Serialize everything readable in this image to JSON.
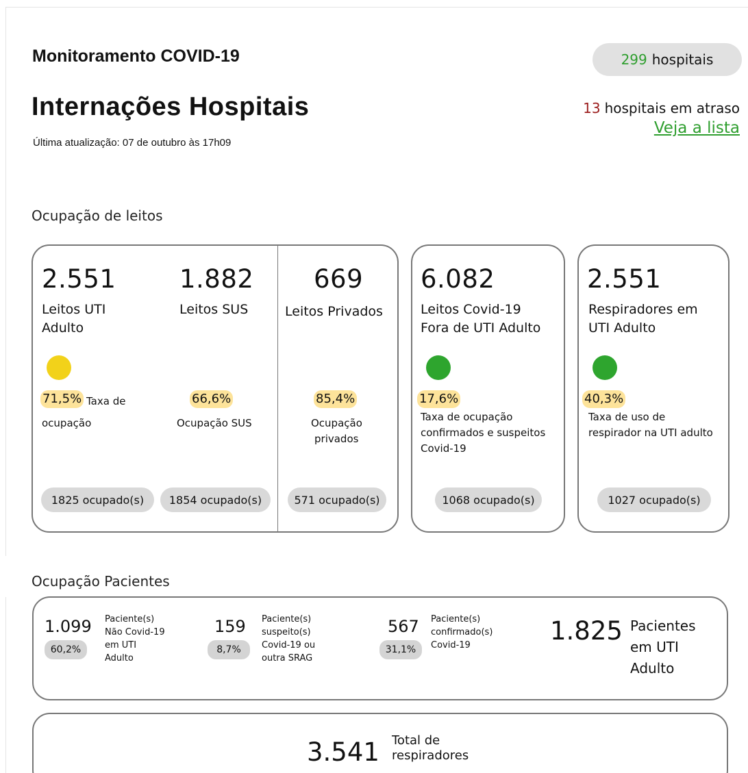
{
  "header": {
    "app_title": "Monitoramento COVID-19",
    "page_title": "Internações Hospitais",
    "last_update": "Última atualização: 07 de outubro às 17h09",
    "hospitals_count": "299",
    "hospitals_label": "hospitais",
    "late_count": "13",
    "late_label": "hospitais em atraso",
    "late_link": "Veja a lista"
  },
  "colors": {
    "yellow_status": "#f2d21a",
    "green_status": "#2ea52e",
    "highlight": "#fde39a",
    "accent_green": "#2e9e2e",
    "alert_red": "#9b1c1c"
  },
  "leitos": {
    "section_title": "Ocupação de leitos",
    "uti": {
      "value": "2.551",
      "label_line1": "Leitos UTI",
      "label_line2": "Adulto",
      "status_icon": "yellow-status-dot",
      "pct": "71,5%",
      "desc_inline": "Taxa de",
      "desc_line2": "ocupação",
      "occupied": "1825 ocupado(s)"
    },
    "sus": {
      "value": "1.882",
      "label": "Leitos SUS",
      "pct": "66,6%",
      "desc": "Ocupação SUS",
      "occupied": "1854 ocupado(s)"
    },
    "privados": {
      "value": "669",
      "label": "Leitos Privados",
      "pct": "85,4%",
      "desc_line1": "Ocupação",
      "desc_line2": "privados",
      "occupied": "571 ocupado(s)"
    },
    "covid_fora": {
      "value": "6.082",
      "label_line1": "Leitos Covid-19",
      "label_line2": "Fora de UTI Adulto",
      "status_icon": "green-status-dot",
      "pct": "17,6%",
      "desc_line1": "Taxa de ocupação",
      "desc_line2": "confirmados e suspeitos",
      "desc_line3": "Covid-19",
      "occupied": "1068 ocupado(s)"
    },
    "respiradores": {
      "value": "2.551",
      "label_line1": "Respiradores em",
      "label_line2": "UTI Adulto",
      "status_icon": "green-status-dot",
      "pct": "40,3%",
      "desc_line1": "Taxa de uso de",
      "desc_line2": "respirador na UTI adulto",
      "occupied": "1027 ocupado(s)"
    }
  },
  "pacientes": {
    "section_title": "Ocupação Pacientes",
    "nao_covid": {
      "value": "1.099",
      "pct": "60,2%",
      "l1": "Paciente(s)",
      "l2": "Não Covid-19",
      "l3": "em UTI",
      "l4": "Adulto"
    },
    "suspeito": {
      "value": "159",
      "pct": "8,7%",
      "l1": "Paciente(s)",
      "l2": "suspeito(s)",
      "l3": "Covid-19 ou",
      "l4": "outra SRAG"
    },
    "confirmado": {
      "value": "567",
      "pct": "31,1%",
      "l1": "Paciente(s)",
      "l2": "confirmado(s)",
      "l3": "Covid-19"
    },
    "total": {
      "value": "1.825",
      "l1": "Pacientes",
      "l2": "em UTI",
      "l3": "Adulto"
    }
  },
  "respiradores_total": {
    "value": "3.541",
    "l1": "Total de",
    "l2": "respiradores"
  }
}
